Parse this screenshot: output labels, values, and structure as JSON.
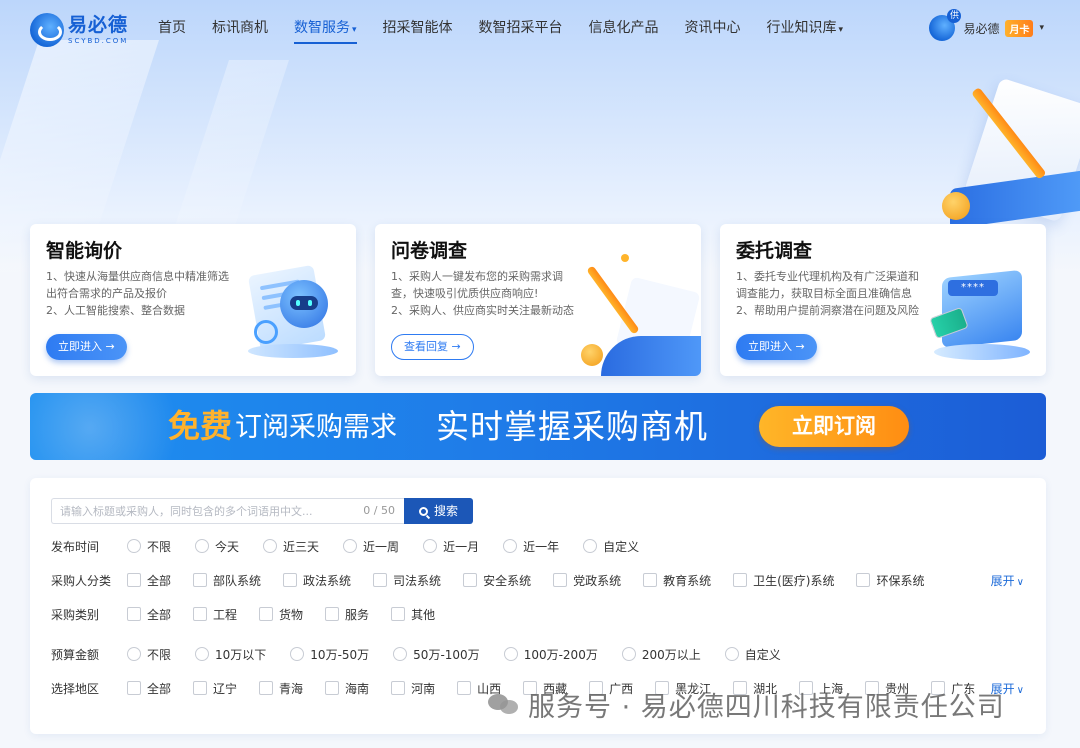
{
  "brand": {
    "name_cn": "易必德",
    "name_en": "SCYBD.COM"
  },
  "nav": {
    "items": [
      {
        "label": "首页",
        "dropdown": false,
        "active": false
      },
      {
        "label": "标讯商机",
        "dropdown": false,
        "active": false
      },
      {
        "label": "数智服务",
        "dropdown": true,
        "active": true
      },
      {
        "label": "招采智能体",
        "dropdown": false,
        "active": false
      },
      {
        "label": "数智招采平台",
        "dropdown": false,
        "active": false
      },
      {
        "label": "信息化产品",
        "dropdown": false,
        "active": false
      },
      {
        "label": "资讯中心",
        "dropdown": false,
        "active": false
      },
      {
        "label": "行业知识库",
        "dropdown": true,
        "active": false
      }
    ],
    "caret": "▾"
  },
  "user": {
    "avatar_badge": "供",
    "name": "易必德",
    "badge": "月卡",
    "caret": "▾"
  },
  "cards": [
    {
      "title": "智能询价",
      "lines": [
        "1、快速从海量供应商信息中精准筛选出符合需求的产品及报价",
        "2、人工智能搜索、整合数据"
      ],
      "button": "立即进入 →",
      "button_style": "filled",
      "art": "ai-robot-illustration"
    },
    {
      "title": "问卷调查",
      "lines": [
        "1、采购人一键发布您的采购需求调查，快速吸引优质供应商响应!",
        "2、采购人、供应商实时关注最新动态"
      ],
      "button": "查看回复 →",
      "button_style": "outline",
      "art": "survey-pen-illustration"
    },
    {
      "title": "委托调查",
      "lines": [
        "1、委托专业代理机构及有广泛渠道和调查能力，获取目标全面且准确信息",
        "2、帮助用户提前洞察潜在问题及风险"
      ],
      "button": "立即进入 →",
      "button_style": "filled",
      "art": "entrust-folder-illustration",
      "art_text": "****"
    }
  ],
  "banner": {
    "free": "免费",
    "subscribe_text": "订阅采购需求",
    "main_text": "实时掌握采购商机",
    "button": "立即订阅",
    "colors": {
      "start": "#1d8ff0",
      "end": "#1c5dd6",
      "accent": "#ffb22c"
    }
  },
  "search": {
    "placeholder": "请输入标题或采购人，同时包含的多个词语用中文...",
    "value": "",
    "count": "0 / 50",
    "button": "搜索"
  },
  "filters": [
    {
      "label": "发布时间",
      "type": "radio",
      "options": [
        "不限",
        "今天",
        "近三天",
        "近一周",
        "近一月",
        "近一年",
        "自定义"
      ],
      "expand": ""
    },
    {
      "label": "采购人分类",
      "type": "checkbox",
      "options": [
        "全部",
        "部队系统",
        "政法系统",
        "司法系统",
        "安全系统",
        "党政系统",
        "教育系统",
        "卫生(医疗)系统",
        "环保系统"
      ],
      "expand": "展开"
    },
    {
      "label": "采购类别",
      "type": "checkbox",
      "options": [
        "全部",
        "工程",
        "货物",
        "服务",
        "其他"
      ],
      "expand": ""
    },
    {
      "label": "预算金额",
      "type": "radio",
      "options": [
        "不限",
        "10万以下",
        "10万-50万",
        "50万-100万",
        "100万-200万",
        "200万以上",
        "自定义"
      ],
      "expand": ""
    },
    {
      "label": "选择地区",
      "type": "checkbox",
      "options": [
        "全部",
        "辽宁",
        "青海",
        "海南",
        "河南",
        "山西",
        "西藏",
        "广西",
        "黑龙江",
        "湖北",
        "上海",
        "贵州",
        "广东"
      ],
      "expand": "展开"
    }
  ],
  "expand_chevron": "∨",
  "watermark": "服务号 · 易必德四川科技有限责任公司",
  "colors": {
    "primary": "#1660d4",
    "button_blue": "#1c57b7",
    "orange": "#ff8d12"
  }
}
